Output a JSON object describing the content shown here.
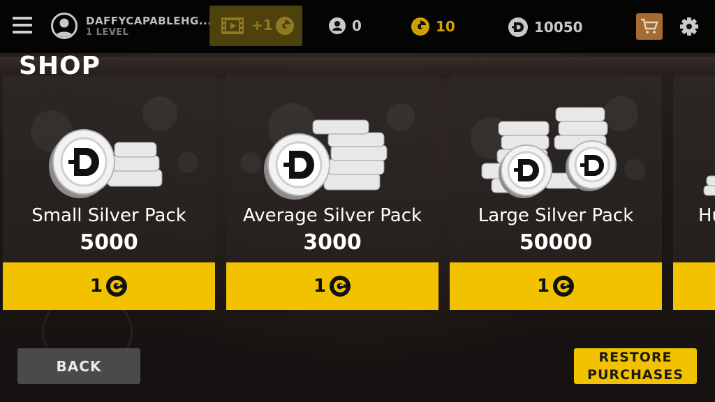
{
  "colors": {
    "accent_yellow": "#f2c200",
    "gold_dark": "#4d420c",
    "cart_orange": "#a66a33",
    "silver": "#d9d9d9"
  },
  "header": {
    "player_name": "DAFFYCAPABLEHG...",
    "player_level": "1 LEVEL",
    "video_reward": "+1",
    "tokens": "0",
    "gold": "10",
    "silver": "10050",
    "icons": [
      "menu-icon",
      "avatar-icon",
      "film-icon",
      "gold-coin-icon",
      "token-icon",
      "silver-coin-icon",
      "cart-icon",
      "gear-icon"
    ]
  },
  "title": "SHOP",
  "packs": [
    {
      "name": "Small Silver Pack",
      "amount": "5000",
      "price": "1"
    },
    {
      "name": "Average Silver Pack",
      "amount": "3000",
      "price": "1"
    },
    {
      "name": "Large Silver Pack",
      "amount": "50000",
      "price": "1"
    },
    {
      "name": "Hu",
      "amount": "",
      "price": ""
    }
  ],
  "footer": {
    "back_label": "BACK",
    "restore_line1": "RESTORE",
    "restore_line2": "PURCHASES"
  }
}
